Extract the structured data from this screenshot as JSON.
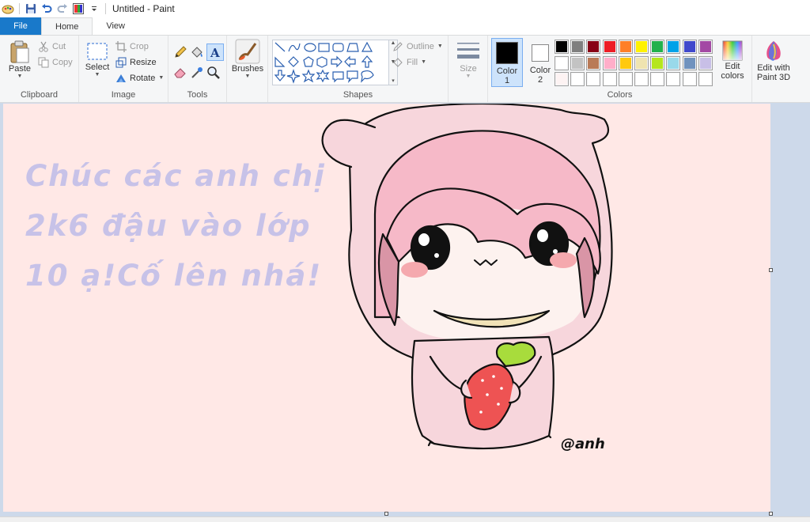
{
  "window": {
    "title": "Untitled - Paint"
  },
  "tabs": [
    {
      "label": "File"
    },
    {
      "label": "Home"
    },
    {
      "label": "View"
    }
  ],
  "clipboard": {
    "paste": "Paste",
    "cut": "Cut",
    "copy": "Copy",
    "group": "Clipboard"
  },
  "image": {
    "select": "Select",
    "crop": "Crop",
    "resize": "Resize",
    "rotate": "Rotate",
    "group": "Image"
  },
  "tools": {
    "group": "Tools"
  },
  "brushes": {
    "label": "Brushes"
  },
  "shapes": {
    "outline": "Outline",
    "fill": "Fill",
    "group": "Shapes"
  },
  "size": {
    "label": "Size"
  },
  "colors": {
    "color1": "Color",
    "color1_num": "1",
    "color2": "Color",
    "color2_num": "2",
    "edit": "Edit",
    "edit2": "colors",
    "group": "Colors",
    "color1_value": "#000000",
    "color2_value": "#ffffff",
    "palette_row1": [
      "#000000",
      "#7f7f7f",
      "#880015",
      "#ed1c24",
      "#ff7f27",
      "#fff200",
      "#22b14c",
      "#00a2e8",
      "#3f48cc",
      "#a349a4"
    ],
    "palette_row2": [
      "#ffffff",
      "#c3c3c3",
      "#b97a57",
      "#ffaec9",
      "#ffc90e",
      "#efe4b0",
      "#b5e61d",
      "#99d9ea",
      "#7092be",
      "#c8bfe7"
    ],
    "palette_row3": [
      "#fdf3f3",
      "#ffffff",
      "#ffffff",
      "#ffffff",
      "#ffffff",
      "#ffffff",
      "#ffffff",
      "#ffffff",
      "#ffffff",
      "#ffffff"
    ]
  },
  "paint3d": {
    "line1": "Edit with",
    "line2": "Paint 3D"
  },
  "canvas": {
    "background": "#ffe8e6",
    "text_lines": [
      "Chúc các anh chị",
      "2k6 đậu vào lớp",
      "10 ạ!Cố lên nhá!"
    ],
    "signature": "@anh"
  }
}
